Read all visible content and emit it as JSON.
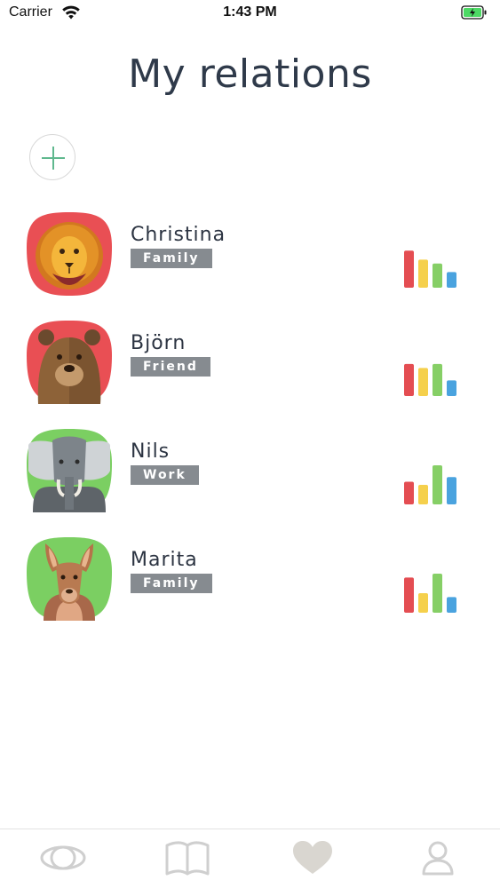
{
  "status_bar": {
    "carrier": "Carrier",
    "time": "1:43 PM",
    "battery_color": "#4cd964"
  },
  "header": {
    "title": "My relations"
  },
  "add_button": {
    "icon": "plus-icon",
    "color": "#5fb88e"
  },
  "relations": [
    {
      "name": "Christina",
      "tag": "Family",
      "avatar": "lion-icon",
      "avatar_bg": "#e94f54",
      "bars": [
        0.95,
        0.72,
        0.62,
        0.4
      ]
    },
    {
      "name": "Björn",
      "tag": "Friend",
      "avatar": "bear-icon",
      "avatar_bg": "#e94f54",
      "bars": [
        0.82,
        0.72,
        0.82,
        0.4
      ]
    },
    {
      "name": "Nils",
      "tag": "Work",
      "avatar": "elephant-icon",
      "avatar_bg": "#7bcf62",
      "bars": [
        0.58,
        0.5,
        1.0,
        0.7
      ]
    },
    {
      "name": "Marita",
      "tag": "Family",
      "avatar": "kangaroo-icon",
      "avatar_bg": "#7bcf62",
      "bars": [
        0.9,
        0.5,
        1.0,
        0.4
      ]
    }
  ],
  "bar_colors": [
    "#e44d52",
    "#f5d04c",
    "#86cf66",
    "#4aa3df"
  ],
  "tab_bar": {
    "tabs": [
      "eye-icon",
      "book-icon",
      "heart-icon",
      "user-icon"
    ],
    "active_index": 2
  }
}
